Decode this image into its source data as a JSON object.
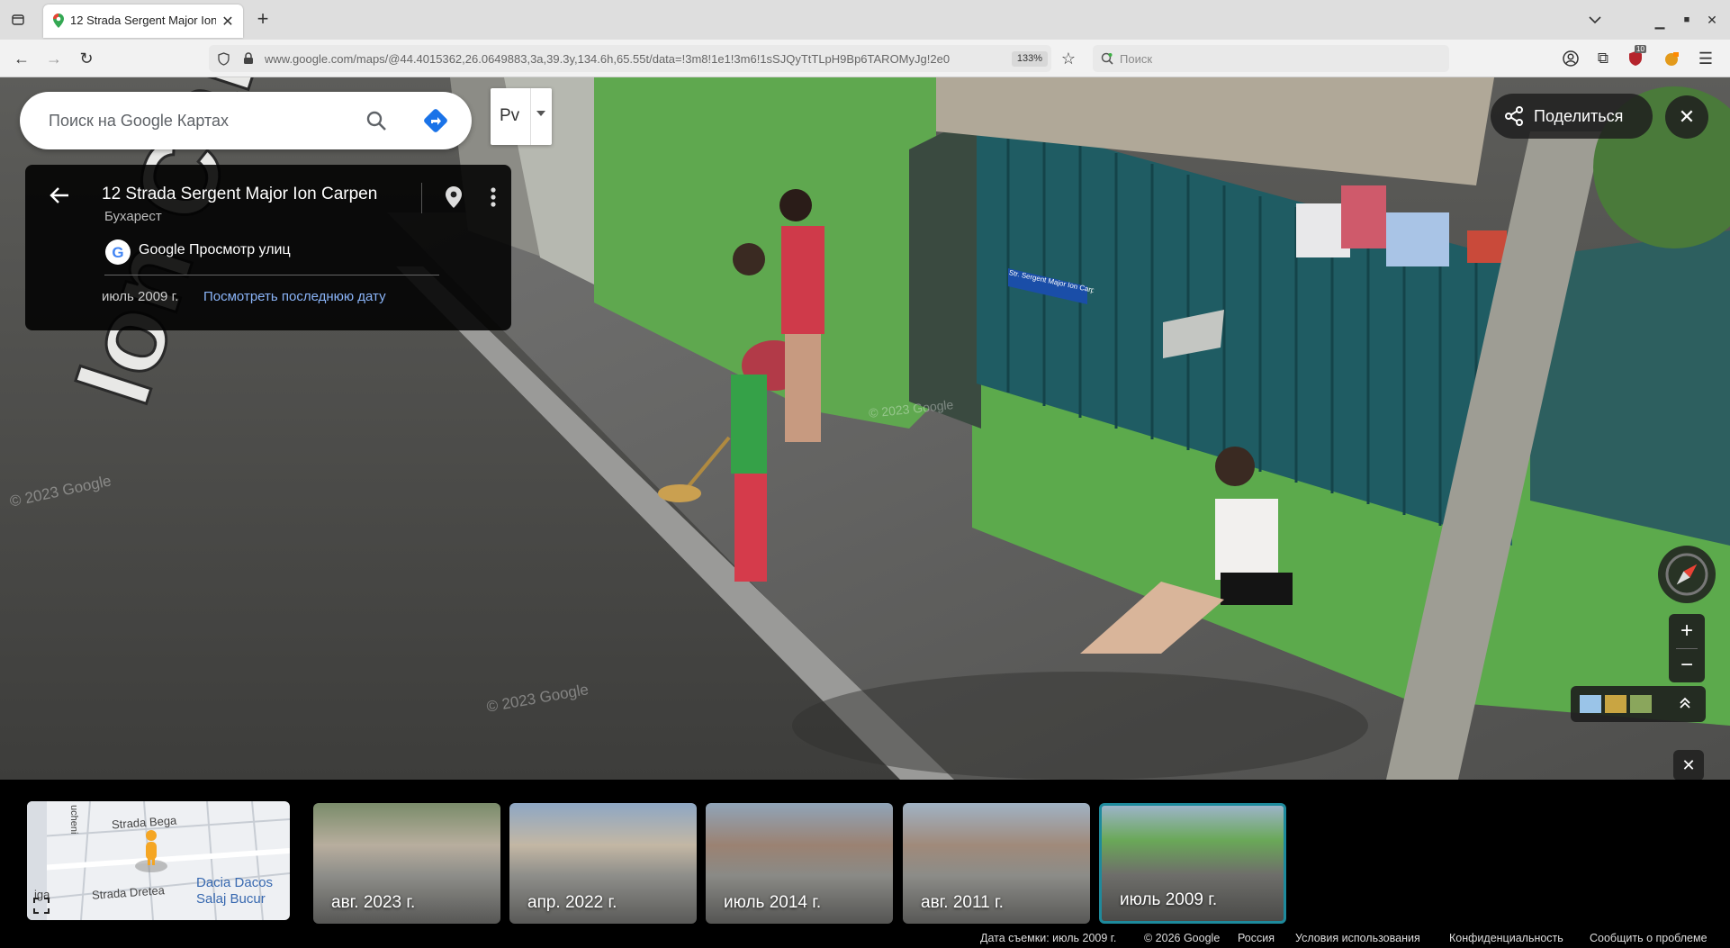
{
  "browser": {
    "tab_title": "12 Strada Sergent Major Ion",
    "new_tab": "+",
    "url": "www.google.com/maps/@44.4015362,26.0649883,3a,39.3y,134.6h,65.55t/data=!3m8!1e1!3m6!1sSJQyTtTLpH9Bp6TAROMyJg!2e0",
    "zoom": "133%",
    "search_placeholder": "Поиск",
    "ext_badge_count": "10"
  },
  "maps": {
    "search_placeholder": "Поиск на Google Картах",
    "layer_label": "Pv",
    "place": {
      "title": "12 Strada Sergent Major Ion Carpen",
      "city": "Бухарест",
      "source": "Google Просмотр улиц",
      "date": "июль 2009 г.",
      "latest_link": "Посмотреть последнюю дату"
    },
    "share_label": "Поделиться",
    "zoom_in": "+",
    "zoom_out": "−",
    "road_text": "Ion Carpen",
    "street_sign": "Str. Sergent Major Ion Carpe"
  },
  "minimap": {
    "labels": [
      "Strada Bega",
      "Strada Dretea",
      "Dacia Dacos",
      "Salaj Bucur",
      "ucheni",
      "iga"
    ]
  },
  "timeline": [
    {
      "label": "авг. 2023 г.",
      "active": false
    },
    {
      "label": "апр. 2022 г.",
      "active": false
    },
    {
      "label": "июль 2014 г.",
      "active": false
    },
    {
      "label": "авг. 2011 г.",
      "active": false
    },
    {
      "label": "июль 2009 г.",
      "active": true
    }
  ],
  "footer": {
    "capture_date": "Дата съемки: июль 2009 г.",
    "copyright": "© 2026 Google",
    "region": "Россия",
    "terms": "Условия использования",
    "privacy": "Конфиденциальность",
    "report": "Сообщить о проблеме"
  },
  "watermarks": [
    "© 2023 Google",
    "© 2023 Google",
    "© 2023 Google"
  ],
  "colors": {
    "link": "#8ab4f8",
    "active_border": "#1e8a9c",
    "directions": "#1a73e8"
  }
}
